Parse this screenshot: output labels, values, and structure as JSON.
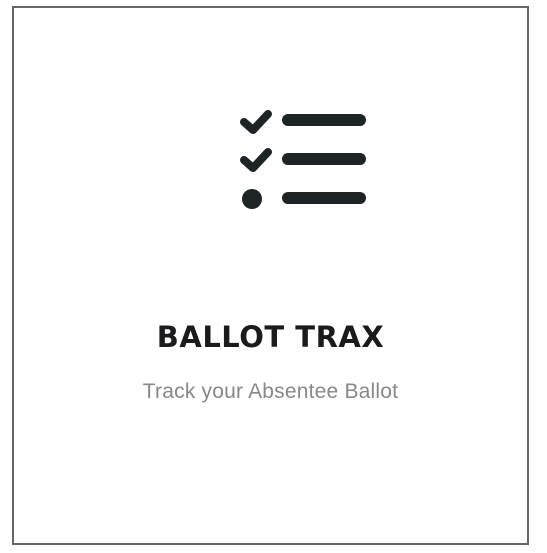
{
  "card": {
    "title": "BALLOT TRAX",
    "subtitle": "Track your Absentee Ballot",
    "icon": "checklist-icon"
  },
  "colors": {
    "icon": "#1e2426",
    "title": "#1b1b1d",
    "subtitle": "#888888",
    "border": "#666666"
  }
}
